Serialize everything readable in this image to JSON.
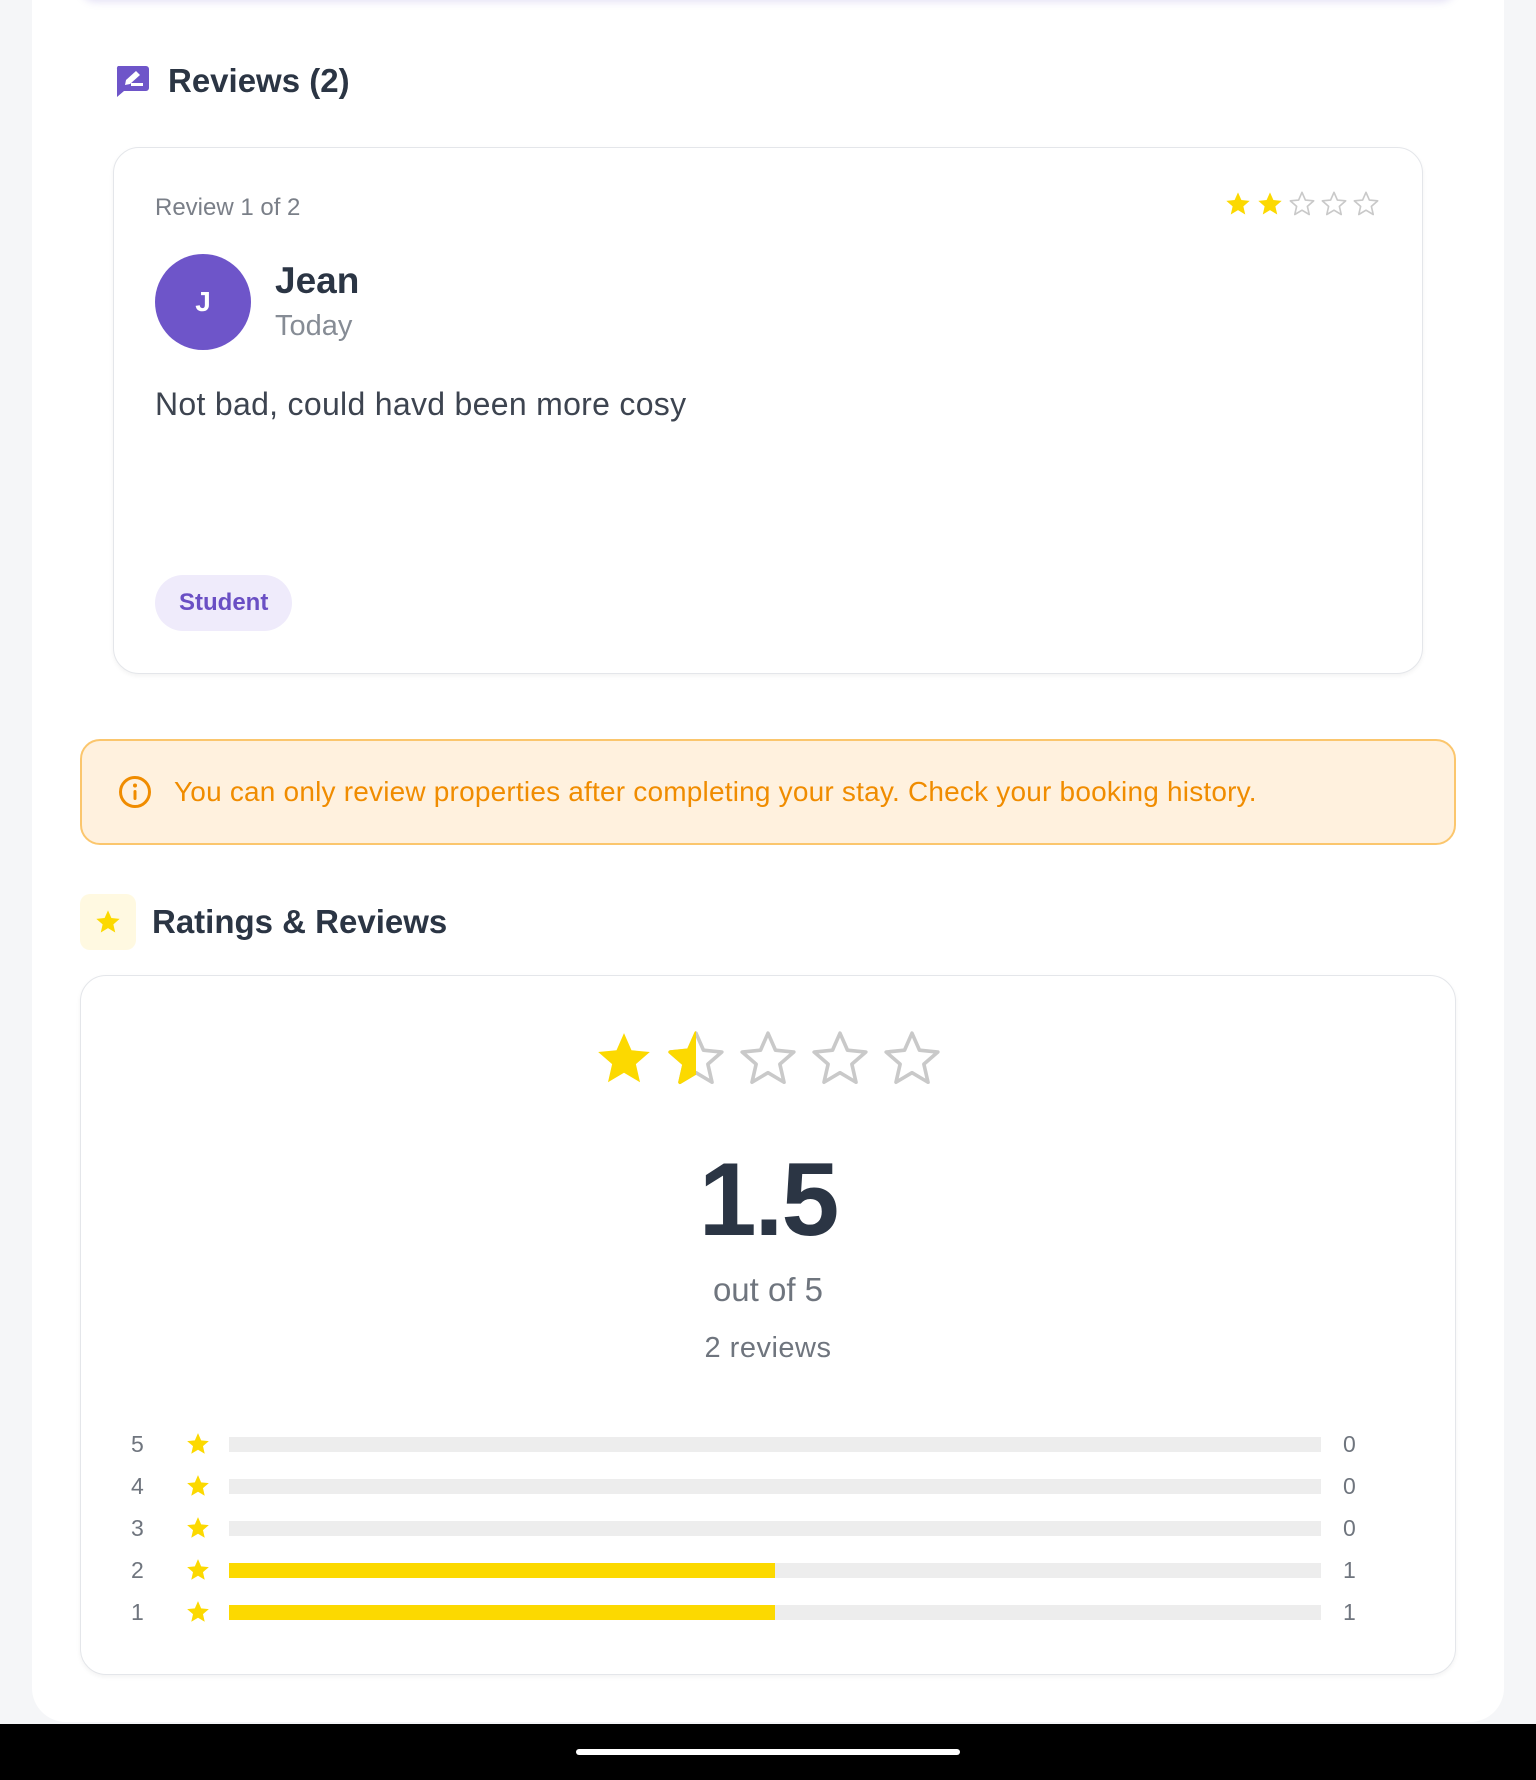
{
  "reviews_section": {
    "title": "Reviews (2)",
    "review": {
      "counter": "Review 1 of 2",
      "rating": 2,
      "max_rating": 5,
      "avatar_initial": "J",
      "name": "Jean",
      "date": "Today",
      "text": "Not bad, could havd been more cosy",
      "tag": "Student"
    }
  },
  "alert": {
    "icon": "info-circle-icon",
    "text": "You can only review properties after completing your stay. Check your booking history."
  },
  "ratings_section": {
    "title": "Ratings & Reviews",
    "average": "1.5",
    "average_value": 1.5,
    "out_of": "out of 5",
    "total": "2 reviews",
    "distribution": [
      {
        "stars": "5",
        "count": "0",
        "fraction": 0
      },
      {
        "stars": "4",
        "count": "0",
        "fraction": 0
      },
      {
        "stars": "3",
        "count": "0",
        "fraction": 0
      },
      {
        "stars": "2",
        "count": "1",
        "fraction": 0.5
      },
      {
        "stars": "1",
        "count": "1",
        "fraction": 0.5
      }
    ]
  },
  "colors": {
    "accent_purple": "#6e55c9",
    "star_yellow": "#fcd900",
    "alert_orange": "#f08c00"
  }
}
